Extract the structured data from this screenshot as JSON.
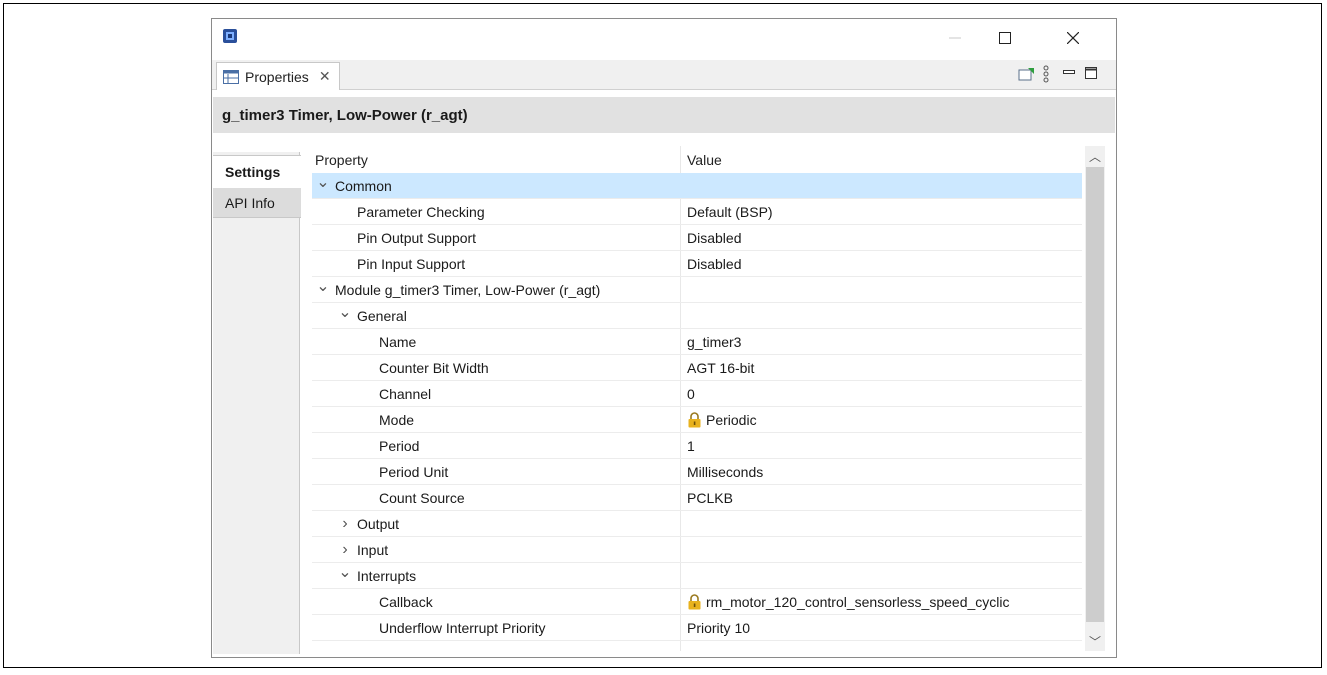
{
  "window": {
    "view_tab_label": "Properties",
    "title": "g_timer3 Timer, Low-Power (r_agt)"
  },
  "side_tabs": [
    "Settings",
    "API Info"
  ],
  "table": {
    "headers": {
      "property": "Property",
      "value": "Value"
    },
    "rows": [
      {
        "label": "Common",
        "value": "",
        "level": 0,
        "twisty": "expanded",
        "selected": true,
        "locked": false
      },
      {
        "label": "Parameter Checking",
        "value": "Default (BSP)",
        "level": 1,
        "twisty": "none",
        "selected": false,
        "locked": false
      },
      {
        "label": "Pin Output Support",
        "value": "Disabled",
        "level": 1,
        "twisty": "none",
        "selected": false,
        "locked": false
      },
      {
        "label": "Pin Input Support",
        "value": "Disabled",
        "level": 1,
        "twisty": "none",
        "selected": false,
        "locked": false
      },
      {
        "label": "Module g_timer3 Timer, Low-Power (r_agt)",
        "value": "",
        "level": 0,
        "twisty": "expanded",
        "selected": false,
        "locked": false
      },
      {
        "label": "General",
        "value": "",
        "level": 1,
        "twisty": "expanded",
        "selected": false,
        "locked": false
      },
      {
        "label": "Name",
        "value": "g_timer3",
        "level": 2,
        "twisty": "none",
        "selected": false,
        "locked": false
      },
      {
        "label": "Counter Bit Width",
        "value": "AGT 16-bit",
        "level": 2,
        "twisty": "none",
        "selected": false,
        "locked": false
      },
      {
        "label": "Channel",
        "value": "0",
        "level": 2,
        "twisty": "none",
        "selected": false,
        "locked": false
      },
      {
        "label": "Mode",
        "value": "Periodic",
        "level": 2,
        "twisty": "none",
        "selected": false,
        "locked": true
      },
      {
        "label": "Period",
        "value": "1",
        "level": 2,
        "twisty": "none",
        "selected": false,
        "locked": false
      },
      {
        "label": "Period Unit",
        "value": "Milliseconds",
        "level": 2,
        "twisty": "none",
        "selected": false,
        "locked": false
      },
      {
        "label": "Count Source",
        "value": "PCLKB",
        "level": 2,
        "twisty": "none",
        "selected": false,
        "locked": false
      },
      {
        "label": "Output",
        "value": "",
        "level": 1,
        "twisty": "collapsed",
        "selected": false,
        "locked": false
      },
      {
        "label": "Input",
        "value": "",
        "level": 1,
        "twisty": "collapsed",
        "selected": false,
        "locked": false
      },
      {
        "label": "Interrupts",
        "value": "",
        "level": 1,
        "twisty": "expanded",
        "selected": false,
        "locked": false
      },
      {
        "label": "Callback",
        "value": "rm_motor_120_control_sensorless_speed_cyclic",
        "level": 2,
        "twisty": "none",
        "selected": false,
        "locked": true
      },
      {
        "label": "Underflow Interrupt Priority",
        "value": "Priority 10",
        "level": 2,
        "twisty": "none",
        "selected": false,
        "locked": false
      }
    ]
  },
  "icons": {
    "app": "app-chip-icon",
    "view_tab": "properties-view-icon",
    "toolbar": [
      "pin-editor-icon",
      "view-menu-icon",
      "minimize-view-icon",
      "maximize-view-icon"
    ],
    "lock": "lock-icon"
  },
  "colors": {
    "selected_row": "#cce8ff",
    "header_band": "#e1e1e1",
    "lock": "#e8b21e"
  }
}
